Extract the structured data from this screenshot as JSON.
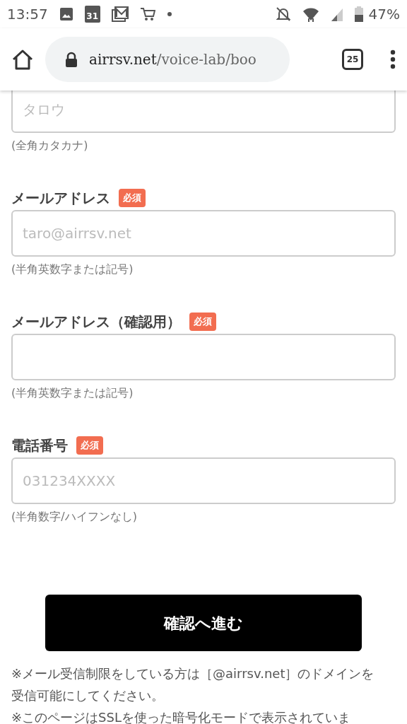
{
  "status_bar": {
    "time": "13:57",
    "calendar_day": "31",
    "battery_text": "47%"
  },
  "browser": {
    "url_host": "airrsv.net",
    "url_path": "/voice-lab/boo",
    "tab_count": "25"
  },
  "fields": [
    {
      "placeholder": "タロウ",
      "hint": "(全角カタカナ)"
    },
    {
      "label": "メールアドレス",
      "badge": "必須",
      "placeholder": "taro@airrsv.net",
      "hint": "(半角英数字または記号)"
    },
    {
      "label": "メールアドレス（確認用）",
      "badge": "必須",
      "hint": "(半角英数字または記号)"
    },
    {
      "label": "電話番号",
      "badge": "必須",
      "placeholder": "031234XXXX",
      "hint": "(半角数字/ハイフンなし)"
    }
  ],
  "submit_button": "確認へ進む",
  "notes": [
    "※メール受信制限をしている方は［@airrsv.net］のドメインを受信可能にしてください。",
    "※このページはSSLを使った暗号化モードで表示されていま"
  ]
}
